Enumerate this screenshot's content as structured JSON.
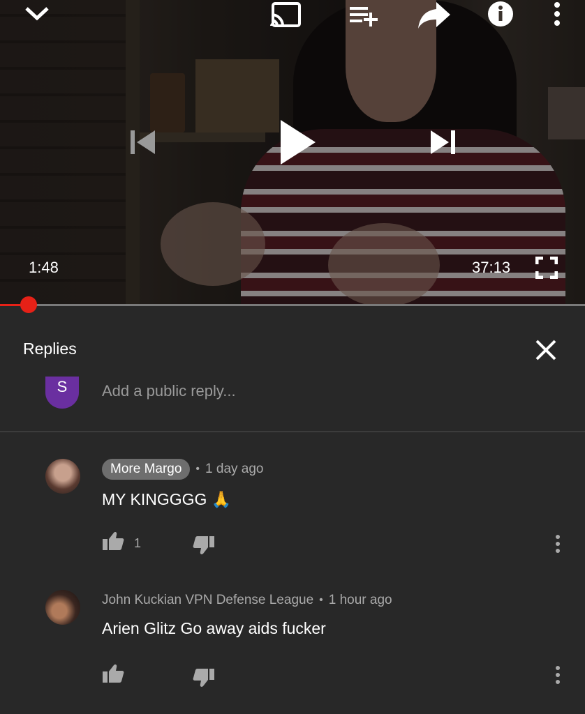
{
  "player": {
    "current_time": "1:48",
    "duration": "37:13",
    "progress_fraction": 0.0484,
    "accent_color": "#e62117",
    "icons": [
      "chevron-down-icon",
      "cast-icon",
      "add-to-playlist-icon",
      "share-icon",
      "info-icon",
      "more-vert-icon",
      "previous-icon",
      "play-icon",
      "next-icon",
      "fullscreen-icon"
    ]
  },
  "replies": {
    "title": "Replies",
    "add_reply_placeholder": "Add a public reply...",
    "user_initial": "S",
    "comments": [
      {
        "author": "More Margo",
        "author_highlighted": true,
        "time": "1 day ago",
        "text": "MY KINGGGG 🙏",
        "likes": "1"
      },
      {
        "author": "John Kuckian VPN Defense League",
        "author_highlighted": false,
        "time": "1 hour ago",
        "text": "Arien Glitz Go away aids fucker",
        "likes": ""
      }
    ]
  }
}
